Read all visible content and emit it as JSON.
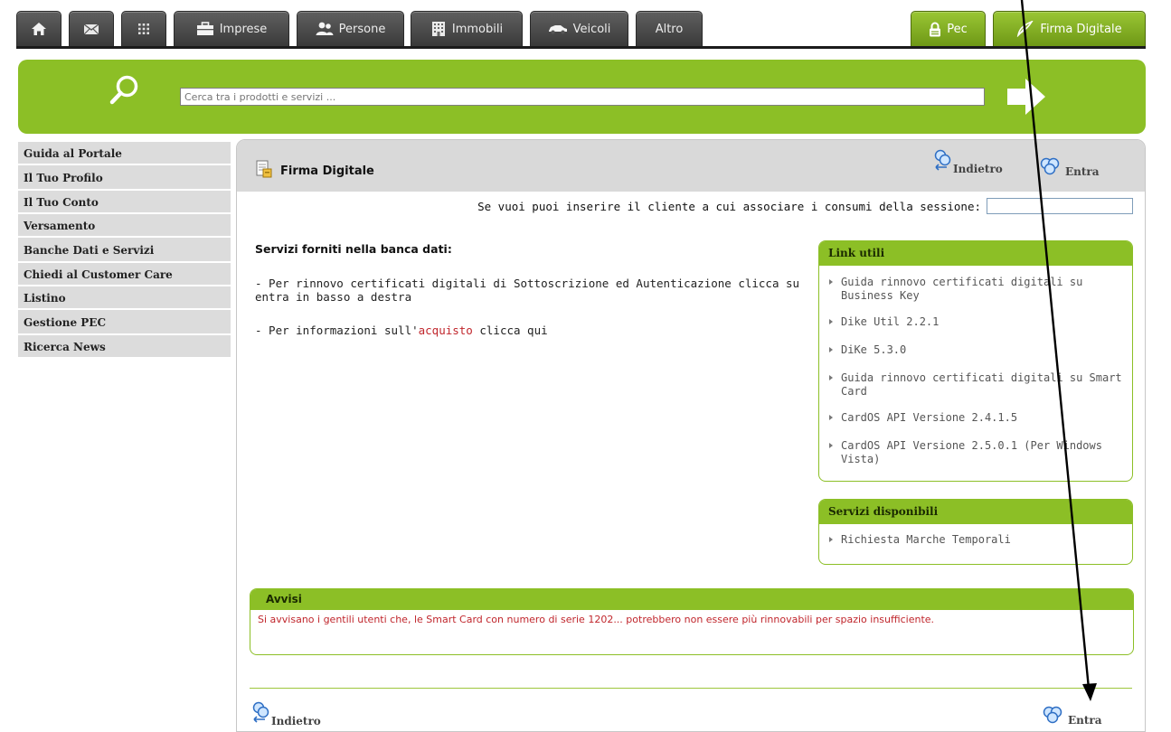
{
  "colors": {
    "accent_green": "#8cbf26",
    "tab_dark": "#4a4a4a",
    "link_red": "#c0262c"
  },
  "nav": {
    "tabs": [
      {
        "label": "",
        "icon": "home-icon"
      },
      {
        "label": "",
        "icon": "mail-icon"
      },
      {
        "label": "",
        "icon": "grid-icon"
      },
      {
        "label": "Imprese",
        "icon": "briefcase-icon"
      },
      {
        "label": "Persone",
        "icon": "people-icon"
      },
      {
        "label": "Immobili",
        "icon": "building-icon"
      },
      {
        "label": "Veicoli",
        "icon": "car-icon"
      },
      {
        "label": "Altro",
        "icon": ""
      }
    ],
    "right_tabs": [
      {
        "label": "Pec",
        "icon": "lock-icon"
      },
      {
        "label": "Firma Digitale",
        "icon": "pen-icon"
      }
    ]
  },
  "search": {
    "placeholder": "Cerca tra i prodotti e servizi ...",
    "value": ""
  },
  "sidebar": {
    "items": [
      "Guida al Portale",
      "Il Tuo Profilo",
      "Il Tuo Conto",
      "Versamento",
      "Banche Dati e Servizi",
      "Chiedi al Customer Care",
      "Listino",
      "Gestione PEC",
      "Ricerca News"
    ]
  },
  "panel": {
    "title": "Firma Digitale",
    "back_label": "Indietro",
    "enter_label": "Entra",
    "session_prompt": "Se vuoi puoi inserire il cliente a cui associare i consumi della sessione:",
    "session_value": "",
    "services_title": "Servizi forniti nella banca dati:",
    "service_line_1": "- Per rinnovo certificati digitali di Sottoscrizione ed Autenticazione clicca su entra in basso a destra",
    "service_line_2_prefix": "- Per informazioni sull'",
    "service_line_2_link": "acquisto",
    "service_line_2_suffix": " clicca qui"
  },
  "link_utili": {
    "title": "Link utili",
    "links": [
      "Guida rinnovo certificati digitali su Business Key",
      "Dike Util 2.2.1",
      "DiKe 5.3.0",
      "Guida rinnovo certificati digitali su Smart Card",
      "CardOS API Versione 2.4.1.5",
      "CardOS API Versione 2.5.0.1 (Per Windows Vista)"
    ]
  },
  "servizi_disponibili": {
    "title": "Servizi disponibili",
    "items": [
      "Richiesta Marche Temporali"
    ]
  },
  "avvisi": {
    "title": "Avvisi",
    "text": "Si avvisano i gentili utenti che, le Smart Card con numero di serie 1202... potrebbero non essere più rinnovabili per spazio insufficiente."
  },
  "footer": {
    "back_label": "Indietro",
    "enter_label": "Entra"
  }
}
